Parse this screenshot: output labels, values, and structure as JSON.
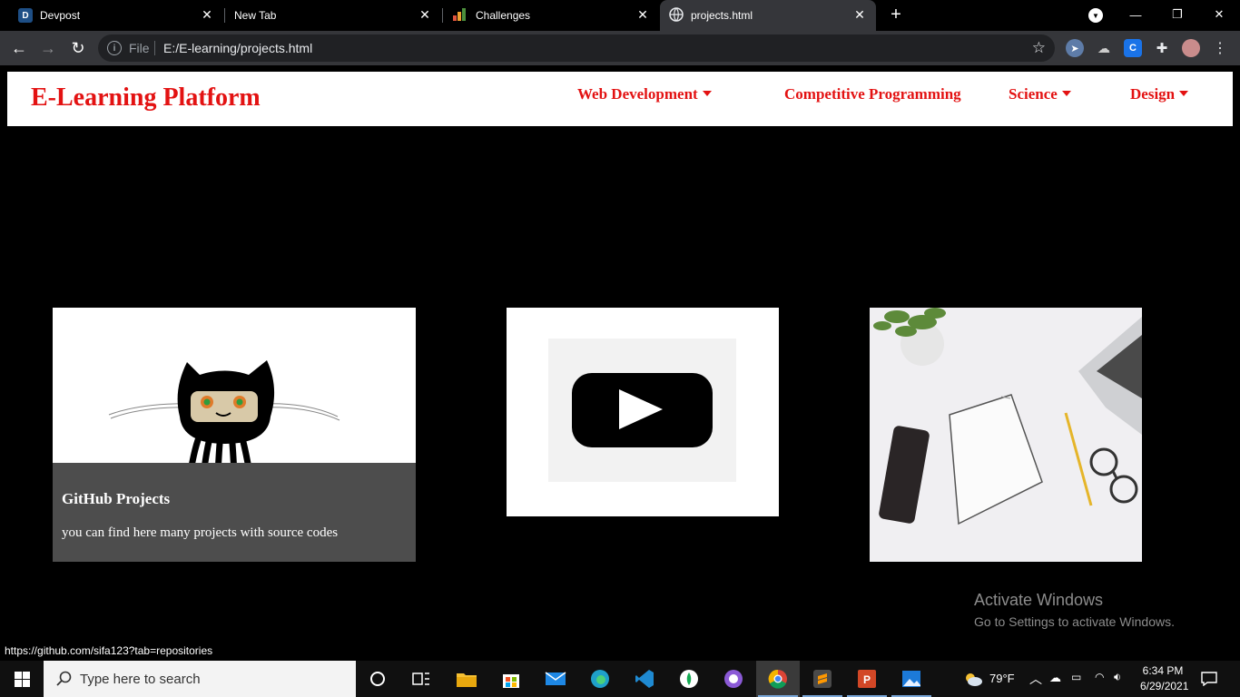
{
  "browser": {
    "tabs": [
      {
        "title": "Devpost",
        "favicon": "devpost-favicon",
        "favicon_letter": "D",
        "active": false
      },
      {
        "title": "New Tab",
        "favicon": "none",
        "active": false
      },
      {
        "title": "Challenges",
        "favicon": "challenges-favicon",
        "active": false
      },
      {
        "title": "projects.html",
        "favicon": "globe-icon",
        "active": true
      }
    ],
    "address_bar": {
      "scheme_label": "File",
      "url": "E:/E-learning/projects.html"
    }
  },
  "site": {
    "brand": "E-Learning Platform",
    "nav": [
      {
        "label": "Web Development",
        "has_dropdown": true
      },
      {
        "label": "Competitive Programming",
        "has_dropdown": false
      },
      {
        "label": "Science",
        "has_dropdown": true
      },
      {
        "label": "Design",
        "has_dropdown": true
      }
    ],
    "cards": [
      {
        "title": "GitHub Projects",
        "description": "you can find here many projects with source codes",
        "image": "octocat-illustration"
      },
      {
        "image": "video-play-thumbnail"
      },
      {
        "image": "desk-workspace-photo"
      }
    ]
  },
  "status_bar": {
    "hover_url": "https://github.com/sifa123?tab=repositories"
  },
  "watermark": {
    "title": "Activate Windows",
    "subtitle": "Go to Settings to activate Windows."
  },
  "taskbar": {
    "search_placeholder": "Type here to search",
    "weather": "79°F",
    "time": "6:34 PM",
    "date": "6/29/2021"
  },
  "colors": {
    "brand_red": "#e31212",
    "page_background": "#000000",
    "card_overlay": "#4d4d4d"
  }
}
